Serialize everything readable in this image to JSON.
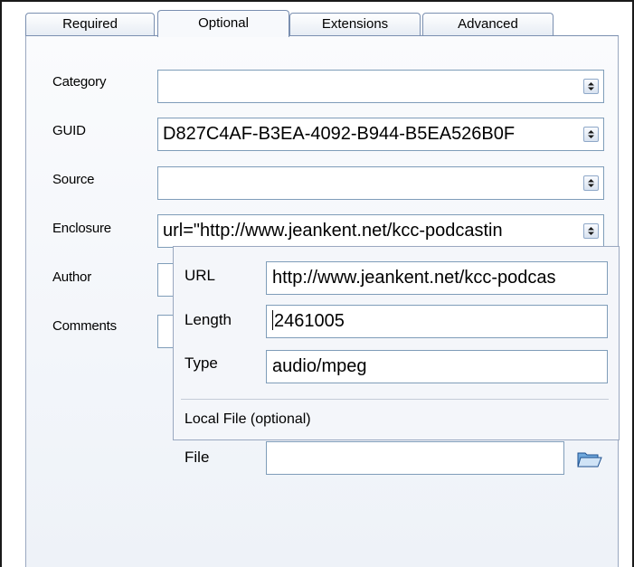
{
  "tabs": [
    {
      "label": "Required"
    },
    {
      "label": "Optional"
    },
    {
      "label": "Extensions"
    },
    {
      "label": "Advanced"
    }
  ],
  "fields": {
    "category": {
      "label": "Category",
      "value": ""
    },
    "guid": {
      "label": "GUID",
      "value": "D827C4AF-B3EA-4092-B944-B5EA526B0F"
    },
    "source": {
      "label": "Source",
      "value": ""
    },
    "enclosure": {
      "label": "Enclosure",
      "value": "url=\"http://www.jeankent.net/kcc-podcastin"
    },
    "author": {
      "label": "Author"
    },
    "comments": {
      "label": "Comments"
    }
  },
  "enclosure_popup": {
    "url": {
      "label": "URL",
      "value": "http://www.jeankent.net/kcc-podcas"
    },
    "length": {
      "label": "Length",
      "value": "2461005"
    },
    "type": {
      "label": "Type",
      "value": "audio/mpeg"
    },
    "local_file_heading": "Local File (optional)",
    "file": {
      "label": "File",
      "value": ""
    },
    "browse_icon": "folder-open-icon"
  }
}
